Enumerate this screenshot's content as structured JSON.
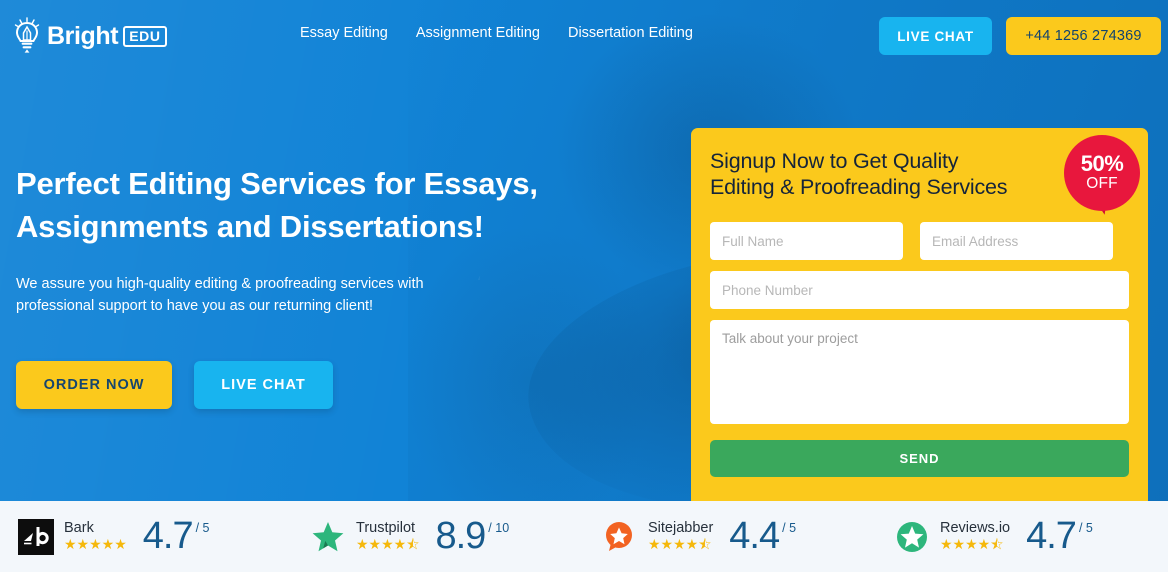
{
  "brand": {
    "name": "Bright",
    "badge": "EDU",
    "icon": "lightbulb-pencil-icon",
    "colors": {
      "primary_blue": "#1183d6",
      "cyan": "#18b4ef",
      "yellow": "#fbc91c",
      "green": "#3aa85c",
      "red": "#e8173d",
      "navy_text": "#16466f"
    }
  },
  "header": {
    "nav": [
      {
        "label": "Essay Editing"
      },
      {
        "label": "Assignment Editing"
      },
      {
        "label": "Dissertation Editing"
      }
    ],
    "live_chat_label": "LIVE CHAT",
    "phone_label": "+44 1256 274369"
  },
  "hero": {
    "title_line1": "Perfect Editing Services for Essays,",
    "title_line2": "Assignments and Dissertations!",
    "subtitle": "We assure you high-quality editing & proofreading services with professional support to have you as our returning client!",
    "order_label": "ORDER NOW",
    "chat_label": "LIVE CHAT"
  },
  "form": {
    "heading_line1": "Signup Now to Get Quality",
    "heading_line2": "Editing & Proofreading Services",
    "badge_percent": "50%",
    "badge_off": "OFF",
    "fields": {
      "full_name_placeholder": "Full Name",
      "email_placeholder": "Email Address",
      "phone_placeholder": "Phone Number",
      "message_placeholder": "Talk about your project"
    },
    "send_label": "SEND"
  },
  "reviews": [
    {
      "name": "Bark",
      "logo": "bark-logo",
      "stars": "★★★★★",
      "score": "4.7",
      "denominator": "/ 5"
    },
    {
      "name": "Trustpilot",
      "logo": "trustpilot-star-icon",
      "stars": "★★★★⯪",
      "score": "8.9",
      "denominator": "/ 10"
    },
    {
      "name": "Sitejabber",
      "logo": "sitejabber-bubble-icon",
      "stars": "★★★★⯪",
      "score": "4.4",
      "denominator": "/ 5"
    },
    {
      "name": "Reviews.io",
      "logo": "reviewsio-circle-icon",
      "stars": "★★★★⯪",
      "score": "4.7",
      "denominator": "/ 5"
    }
  ]
}
